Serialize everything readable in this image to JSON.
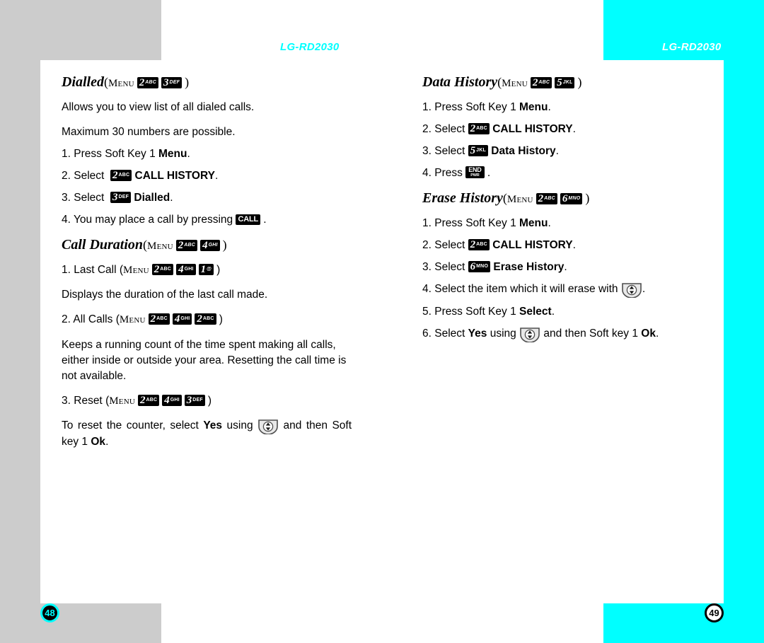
{
  "document": {
    "model": "LG-RD2030",
    "header_left": "LG-RD2030",
    "header_right": "LG-RD2030",
    "page_left": "48",
    "page_right": "49",
    "colors": {
      "accent_cyan": "#00ffff",
      "frame_gray": "#cccccc",
      "text": "#000000"
    }
  },
  "keys": {
    "menu_word": "Menu",
    "k1": {
      "digit": "1",
      "letters": "@"
    },
    "k2": {
      "digit": "2",
      "letters": "ABC"
    },
    "k3": {
      "digit": "3",
      "letters": "DEF"
    },
    "k4": {
      "digit": "4",
      "letters": "GHI"
    },
    "k5": {
      "digit": "5",
      "letters": "JKL"
    },
    "k6": {
      "digit": "6",
      "letters": "MNO"
    },
    "call": "CALL",
    "end_top": "END",
    "end_bottom": "PWR"
  },
  "left_column": {
    "dialled": {
      "title": "Dialled",
      "open_paren": "(",
      "close_paren": ")",
      "desc1": "Allows you to view list of all dialed calls.",
      "desc2": "Maximum 30 numbers are possible.",
      "step1_num": "1.",
      "step1_a": "Press",
      "step1_b": "Soft Key 1",
      "step1_bold": "Menu",
      "step1_end": ".",
      "step2_num": "2.",
      "step2_a": "Select",
      "step2_bold": "CALL HISTORY",
      "step2_end": ".",
      "step3_num": "3.",
      "step3_a": "Select",
      "step3_bold": "Dialled",
      "step3_end": ".",
      "step4_num": "4.",
      "step4_a": "You may place a call by pressing",
      "step4_end": "."
    },
    "call_duration": {
      "title": "Call Duration",
      "open_paren": "(",
      "close_paren": ")",
      "sub1_num": "1.",
      "sub1_label": "Last Call",
      "sub1_desc": "Displays the duration of the last call made.",
      "sub2_num": "2.",
      "sub2_label": "All Calls",
      "sub2_desc": "Keeps a running count of the time spent making all calls, either inside or outside your area. Resetting the call time is not available.",
      "sub3_num": "3.",
      "sub3_label": "Reset",
      "sub3_desc_a": "To reset the counter, select",
      "sub3_bold_yes": "Yes",
      "sub3_desc_b": "using",
      "sub3_desc_c": "and then Soft key 1",
      "sub3_bold_ok": "Ok",
      "sub3_end": "."
    }
  },
  "right_column": {
    "data_history": {
      "title": "Data History",
      "open_paren": "(",
      "close_paren": ")",
      "step1_num": "1.",
      "step1_a": "Press",
      "step1_b": "Soft Key 1",
      "step1_bold": "Menu",
      "step1_end": ".",
      "step2_num": "2.",
      "step2_a": "Select",
      "step2_bold": "CALL HISTORY",
      "step2_end": ".",
      "step3_num": "3.",
      "step3_a": "Select",
      "step3_bold": "Data History",
      "step3_end": ".",
      "step4_num": "4.",
      "step4_a": "Press",
      "step4_end": "."
    },
    "erase_history": {
      "title": "Erase History",
      "open_paren": "(",
      "close_paren": ")",
      "step1_num": "1.",
      "step1_a": "Press",
      "step1_b": "Soft Key 1",
      "step1_bold": "Menu",
      "step1_end": ".",
      "step2_num": "2.",
      "step2_a": "Select",
      "step2_bold": "CALL HISTORY",
      "step2_end": ".",
      "step3_num": "3.",
      "step3_a": "Select",
      "step3_bold": "Erase History",
      "step3_end": ".",
      "step4_num": "4.",
      "step4_a": "Select the item which it will erase with",
      "step4_end": ".",
      "step5_num": "5.",
      "step5_a": "Press Soft Key 1",
      "step5_bold": "Select",
      "step5_end": ".",
      "step6_num": "6.",
      "step6_a": "Select",
      "step6_bold_yes": "Yes",
      "step6_b": "using",
      "step6_c": "and then Soft key 1",
      "step6_bold_ok": "Ok",
      "step6_end": "."
    }
  }
}
